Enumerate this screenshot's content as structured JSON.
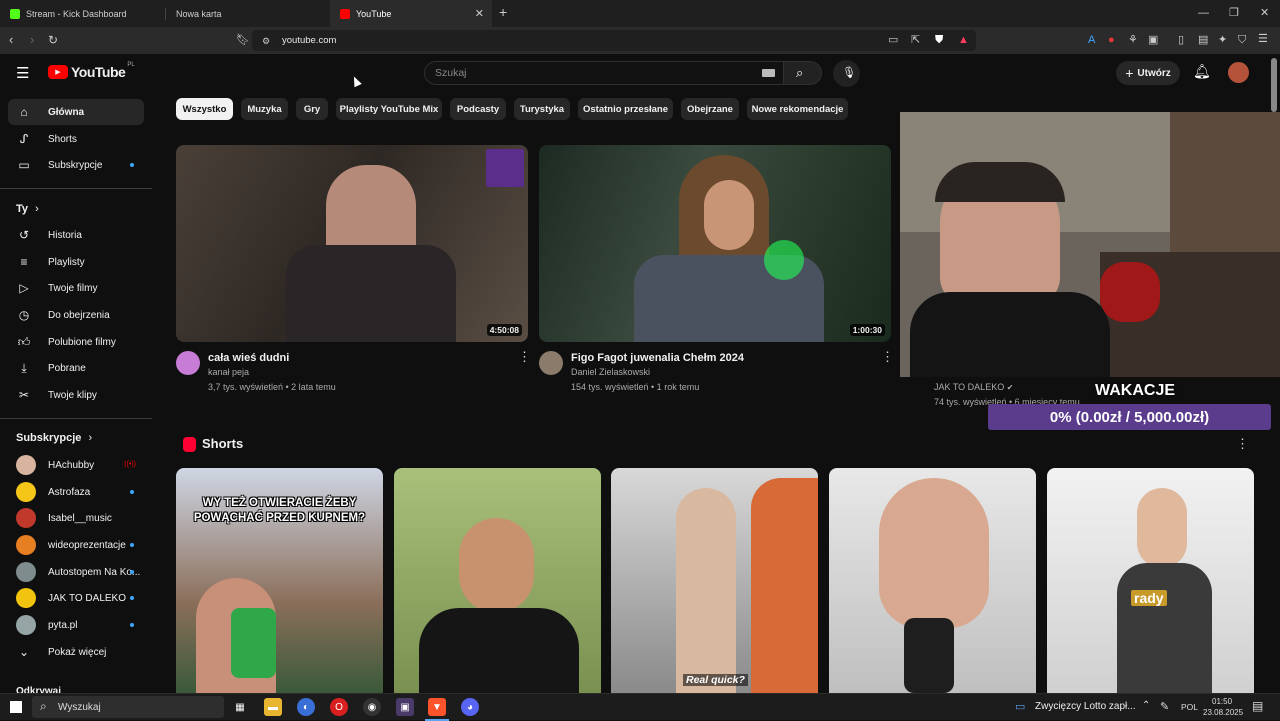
{
  "browser": {
    "tabs": [
      {
        "title": "Stream - Kick Dashboard",
        "color": "#53fc18"
      },
      {
        "title": "Nowa karta",
        "color": "#1f1f1f"
      },
      {
        "title": "YouTube",
        "color": "#ff0000"
      }
    ],
    "url": "youtube.com"
  },
  "yt": {
    "logo": "YouTube",
    "region": "PL",
    "search_placeholder": "Szukaj",
    "create_label": "Utwórz"
  },
  "sidebar": {
    "main": [
      {
        "label": "Główna",
        "icon": "home-icon"
      },
      {
        "label": "Shorts",
        "icon": "shorts-icon"
      },
      {
        "label": "Subskrypcje",
        "icon": "subscriptions-icon"
      }
    ],
    "you_title": "Ty",
    "you": [
      {
        "label": "Historia",
        "icon": "history-icon"
      },
      {
        "label": "Playlisty",
        "icon": "playlists-icon"
      },
      {
        "label": "Twoje filmy",
        "icon": "your-videos-icon"
      },
      {
        "label": "Do obejrzenia",
        "icon": "watch-later-icon"
      },
      {
        "label": "Polubione filmy",
        "icon": "liked-icon"
      },
      {
        "label": "Pobrane",
        "icon": "downloads-icon"
      },
      {
        "label": "Twoje klipy",
        "icon": "clips-icon"
      }
    ],
    "subs_title": "Subskrypcje",
    "subs": [
      {
        "label": "HAchubby",
        "color": "#d8b4a0"
      },
      {
        "label": "Astrofaza",
        "color": "#f5c518"
      },
      {
        "label": "Isabel__music",
        "color": "#c0392b"
      },
      {
        "label": "wideoprezentacje",
        "color": "#e67e22"
      },
      {
        "label": "Autostopem Na Ko...",
        "color": "#7f8c8d"
      },
      {
        "label": "JAK TO DALEKO",
        "color": "#f1c40f"
      },
      {
        "label": "pyta.pl",
        "color": "#95a5a6"
      }
    ],
    "show_more": "Pokaż więcej",
    "next_section": "Odkrywaj"
  },
  "chips": [
    "Wszystko",
    "Muzyka",
    "Gry",
    "Playlisty YouTube Mix",
    "Podcasty",
    "Turystyka",
    "Ostatnio przesłane",
    "Obejrzane",
    "Nowe rekomendacje"
  ],
  "videos": [
    {
      "title": "cała wieś dudni",
      "channel": "kanał peja",
      "meta": "3,7 tys. wyświetleń • 2 lata temu",
      "duration": "4:50:08",
      "avatar_color": "#c77dd6"
    },
    {
      "title": "Figo Fagot juwenalia Chełm 2024",
      "channel": "Daniel Zielaskowski",
      "meta": "154 tys. wyświetleń • 1 rok temu",
      "duration": "1:00:30",
      "avatar_color": "#8a7b6a"
    }
  ],
  "third_video": {
    "channel": "JAK TO DALEKO",
    "meta": "74 tys. wyświetleń • 6 miesięcy temu"
  },
  "overlay": {
    "title": "WAKACJE",
    "progress_text": "0% (0.00zł / 5,000.00zł)",
    "progress": 0
  },
  "shorts_title": "Shorts",
  "shorts": [
    {
      "caption": "WY TEŻ OTWIERACIE ŻEBY POWĄCHAĆ PRZED KUPNEM?"
    },
    {
      "caption": ""
    },
    {
      "caption": "Real quick?"
    },
    {
      "caption": ""
    },
    {
      "caption": "rady"
    }
  ],
  "taskbar": {
    "search": "Wyszukaj",
    "news": "Zwycięzcy Lotto zapł...",
    "lang": "POL",
    "time": "01:50",
    "date": "23.08.2025"
  }
}
